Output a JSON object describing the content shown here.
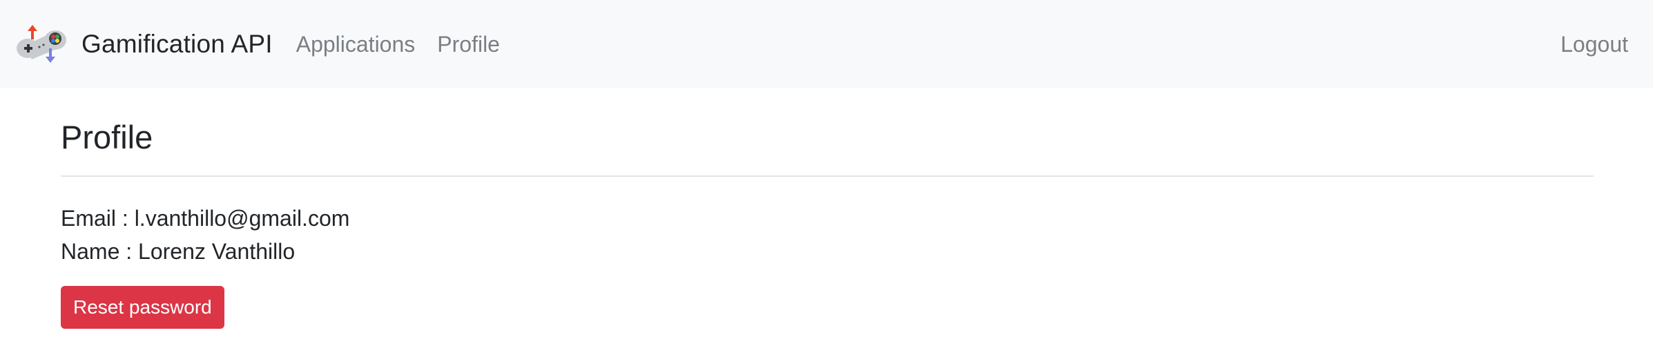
{
  "navbar": {
    "brand_title": "Gamification API",
    "links": [
      {
        "label": "Applications"
      },
      {
        "label": "Profile"
      }
    ],
    "logout_label": "Logout",
    "logo_icon": "gamepad-logo-icon"
  },
  "main": {
    "page_title": "Profile",
    "email_label": "Email",
    "email_value": "l.vanthillo@gmail.com",
    "name_label": "Name",
    "name_value": "Lorenz Vanthillo",
    "reset_button_label": "Reset password"
  },
  "colors": {
    "navbar_bg": "#f8f9fa",
    "danger": "#dc3545",
    "nav_link": "#7a7f85"
  }
}
